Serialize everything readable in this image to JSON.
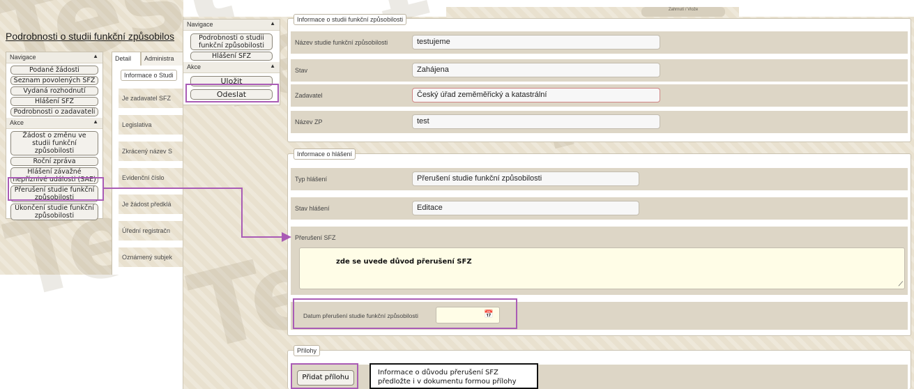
{
  "watermark": "Test",
  "screen1": {
    "page_title": "Podrobnosti o studii funkční způsobilos",
    "navigation": {
      "header": "Navigace",
      "items": [
        "Podané žádosti",
        "Seznam povolených SFZ",
        "Vydaná rozhodnutí",
        "Hlášení SFZ",
        "Podrobnosti o zadavateli"
      ]
    },
    "actions": {
      "header": "Akce",
      "items": [
        "Žádost o změnu ve studii funkční způsobilosti",
        "Roční zpráva",
        "Hlášení závažné nepříznivé události (SAE)",
        "Přerušení studie funkční způsobilosti",
        "Ukončení studie funkční způsobilosti"
      ]
    },
    "tabs": [
      "Detail",
      "Administra"
    ],
    "fieldset_legend": "Informace o Studi",
    "rows": [
      "Je zadavatel SFZ",
      "Legislativa",
      "Zkrácený název S",
      "Evidenční číslo",
      "Je žádost předklá",
      "Úřední registračn",
      "Oznámený subjek"
    ]
  },
  "screen2": {
    "top_partial": "Zahrnutí / Vlože",
    "navigation": {
      "header": "Navigace",
      "items": [
        "Podrobnosti o studii funkční způsobilosti",
        "Hlášení SFZ"
      ]
    },
    "actions": {
      "header": "Akce",
      "items": [
        "Uložit",
        "Odeslat"
      ]
    },
    "study_info": {
      "legend": "Informace o studii funkční způsobilosti",
      "fields": [
        {
          "label": "Název studie funkční způsobilosti",
          "value": "testujeme"
        },
        {
          "label": "Stav",
          "value": "Zahájena"
        },
        {
          "label": "Zadavatel",
          "value": "Český úřad zeměměřický a katastrální"
        },
        {
          "label": "Název ZP",
          "value": "test"
        }
      ]
    },
    "report_info": {
      "legend": "Informace o hlášení",
      "fields": [
        {
          "label": "Typ hlášení",
          "value": "Přerušení studie funkční způsobilosti"
        },
        {
          "label": "Stav hlášení",
          "value": "Editace"
        }
      ],
      "interruption_label": "Přerušení SFZ",
      "interruption_text": "zde se uvede důvod přerušení SFZ",
      "date_label": "Datum přerušení studie funkční způsobilosti",
      "date_value": ""
    },
    "attachments": {
      "legend": "Přílohy",
      "add_button": "Přidat přílohu",
      "note": "Informace o důvodu přerušení SFZ předložte i v dokumentu formou přílohy"
    }
  },
  "colors": {
    "highlight": "#a95bb5",
    "background": "#e9e1cf",
    "textarea": "#fffde7"
  }
}
